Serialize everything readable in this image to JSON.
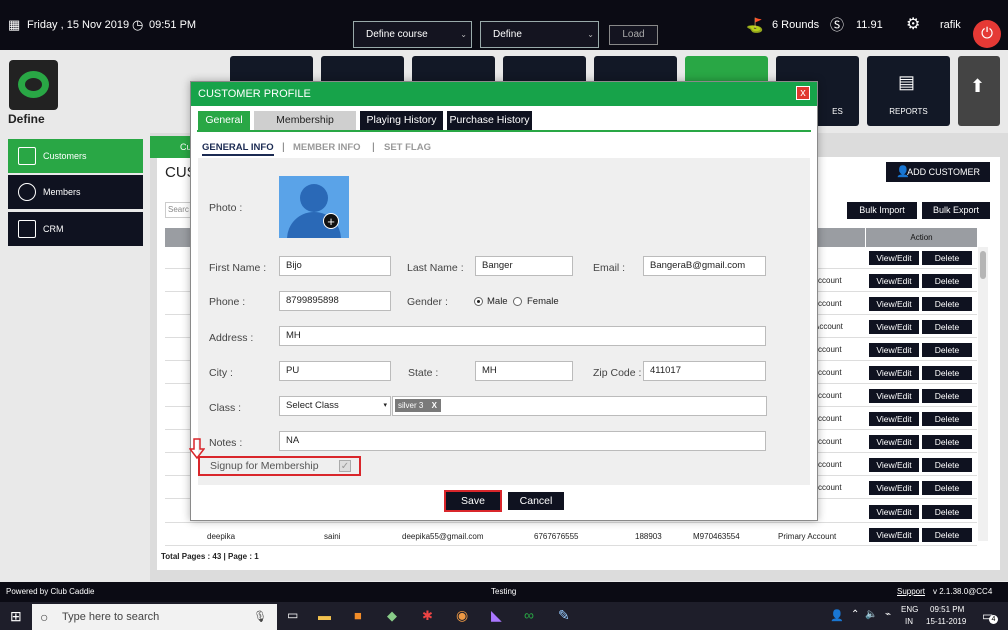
{
  "topbar": {
    "date": "Friday ,  15 Nov 2019",
    "time": "09:51 PM",
    "course_select": "Define  course",
    "define_select": "Define",
    "load_label": "Load",
    "rounds": "6 Rounds",
    "balance": "11.91",
    "user": "rafik"
  },
  "app": {
    "name": "Define"
  },
  "nav_tiles": {
    "sales_label": "ES",
    "reports_label": "REPORTS"
  },
  "sidebar": {
    "items": [
      {
        "label": "Customers"
      },
      {
        "label": "Members"
      },
      {
        "label": "CRM"
      }
    ]
  },
  "background_page": {
    "tab_label": "Cu",
    "heading": "CUS",
    "add_customer": "ADD CUSTOMER",
    "bulk_import": "Bulk Import",
    "bulk_export": "Bulk Export",
    "search_placeholder": "Searc",
    "action_header": "Action",
    "view_edit": "View/Edit",
    "delete": "Delete",
    "account_labels": [
      "ccount",
      "ccount",
      "Account",
      "ccount",
      "ccount",
      "ccount",
      "ccount",
      "ccount",
      "ccount",
      "ccount"
    ],
    "last_row": {
      "first_name": "deepika",
      "last_name": "saini",
      "email": "deepika55@gmail.com",
      "phone": "6767676555",
      "zip": "188903",
      "membership": "M970463554",
      "type": "Primary Account"
    },
    "total_pages": "Total Pages : 43 | Page : 1"
  },
  "modal": {
    "title": "CUSTOMER PROFILE",
    "close": "x",
    "tabs": [
      "General",
      "Membership",
      "Playing History",
      "Purchase History"
    ],
    "subtabs": [
      "GENERAL INFO",
      "MEMBER INFO",
      "SET FLAG"
    ],
    "subtab_sep": "|",
    "form": {
      "photo_label": "Photo :",
      "first_name_label": "First Name :",
      "first_name": "Bijo",
      "last_name_label": "Last Name :",
      "last_name": "Banger",
      "email_label": "Email :",
      "email": "BangeraB@gmail.com",
      "phone_label": "Phone :",
      "phone": "8799895898",
      "gender_label": "Gender :",
      "gender_male": "Male",
      "gender_female": "Female",
      "address_label": "Address :",
      "address": "MH",
      "city_label": "City :",
      "city": "PU",
      "state_label": "State :",
      "state": "MH",
      "zip_label": "Zip Code :",
      "zip": "411017",
      "class_label": "Class :",
      "class_select": "Select Class",
      "class_chip": "silver 3",
      "chip_remove": "X",
      "notes_label": "Notes :",
      "notes": "NA",
      "signup_label": "Signup for Membership"
    },
    "save": "Save",
    "cancel": "Cancel"
  },
  "statusbar": {
    "powered": "Powered by Club Caddie",
    "center": "Testing",
    "support": "Support",
    "version": "v 2.1.38.0@CC4"
  },
  "taskbar": {
    "search_placeholder": "Type here to search",
    "lang1": "ENG",
    "lang2": "IN",
    "time": "09:51 PM",
    "date": "15-11-2019",
    "notifications": "4"
  },
  "colors": {
    "accent_green": "#29a745",
    "dark": "#0f1220",
    "highlight_red": "#d9262b"
  }
}
